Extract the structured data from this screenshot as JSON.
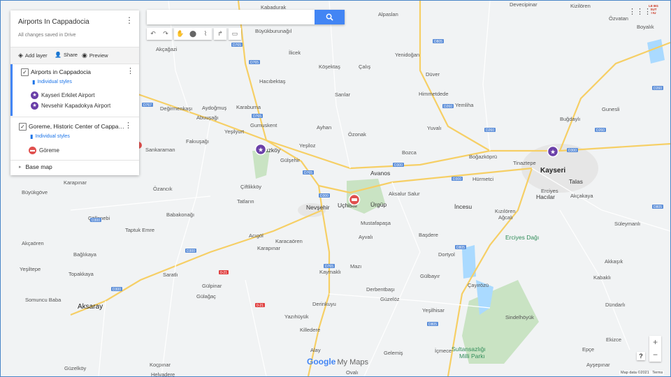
{
  "panel": {
    "title": "Airports In Cappadocia",
    "saved_status": "All changes saved in Drive",
    "add_layer": "Add layer",
    "share": "Share",
    "preview": "Preview",
    "layers": [
      {
        "name": "Airports in Cappadocia",
        "style": "Individual styles",
        "features": [
          "Kayseri Erkilet Airport",
          "Nevsehir Kapadokya Airport"
        ],
        "marker_color": "#6a3fa8"
      },
      {
        "name": "Goreme, Historic Center of Cappa…",
        "style": "Individual styles",
        "features": [
          "Göreme"
        ],
        "marker_color": "#e0504e"
      }
    ],
    "base_map": "Base map"
  },
  "toolbar": {
    "search_placeholder": "",
    "icons": [
      "undo-icon",
      "redo-icon",
      "hand-icon",
      "marker-icon",
      "draw-line-icon",
      "directions-icon",
      "ruler-icon"
    ]
  },
  "map": {
    "places": {
      "kayseri": "Kayseri",
      "nevsehir": "Nevşehir",
      "aksaray": "Aksaray",
      "goreme_park": "Erciyes Dağı",
      "sultan": "Sultansazlığı\nMilli Parkı",
      "uchisar": "Uçhisar",
      "urgup": "Ürgüp",
      "avanos": "Avanos",
      "talas": "Talas",
      "hacilar": "Hacılar",
      "incesu": "İncesu",
      "tuzkoy": "Tuzköy"
    },
    "small_places": [
      "Kabadurak",
      "Alpaslan",
      "Devecipinar",
      "Kizilören",
      "Özvatan",
      "Boyalık",
      "Büyükburunağıl",
      "Akçağazi",
      "İlicek",
      "Yenidoğan",
      "Köşektaş",
      "Çalış",
      "Düver",
      "Hacıbektaş",
      "Sarılar",
      "Himmetdede",
      "Değirmenkaşı",
      "Aydoğmuş",
      "Karaburna",
      "Yemliha",
      "Gunesli",
      "Abuuşağı",
      "Gumuskent",
      "Ayhan",
      "Özonak",
      "Yuvalı",
      "Buğdaylı",
      "Yeşilyurt",
      "Fakıuşağı",
      "Yeşiloz",
      "Bozca",
      "Sankaraman",
      "Gülşehir",
      "Boğazköprü",
      "Tinaztepe",
      "Karapınar",
      "Büyükgöve",
      "Özancık",
      "Çiftlikköy",
      "Hürmetci",
      "Tatların",
      "Akçakaya",
      "Aksalur Salur",
      "Erciyes",
      "Babakonağı",
      "Kızılören",
      "Ağcalı",
      "Çöllenebi",
      "Taptuk Emre",
      "Acıgöl",
      "Mustafapaşa",
      "Başdere",
      "Süleymanlı",
      "Karacaören",
      "Aksaray",
      "Ayvalı",
      "Bağlıkaya",
      "Karapınar",
      "Dortyol",
      "Akçaören",
      "Yeşiltepe",
      "Topakkaya",
      "Saratlı",
      "Mazı",
      "Gülbayır",
      "Akkaşık",
      "Kabaklı",
      "Kaymaklı",
      "Derbentbaşı",
      "Gülpinar",
      "Çayırözü",
      "Somuncu Baba",
      "Güzelöz",
      "Gülağaç",
      "Derinkuyu",
      "Yeşilhisar",
      "Dündarlı",
      "Sindelhöyük",
      "Yazıhüyük",
      "Killedere",
      "Ekizce",
      "Epçe",
      "Alay",
      "Gelemiş",
      "Koçpınar",
      "Güzelköy",
      "İçmece",
      "Ayşepınar",
      "Helvadere",
      "Ovalı"
    ],
    "roads": [
      "D765",
      "D300",
      "D805",
      "D260",
      "D302",
      "D767",
      "D750",
      "0-21"
    ]
  },
  "controls": {
    "zoom_in": "+",
    "zoom_out": "−",
    "help": "?",
    "google": "Google",
    "my_maps": "My Maps",
    "map_data": "Map data ©2021",
    "terms": "Terms",
    "brand": "LE BG\nSUT\nI IU"
  }
}
